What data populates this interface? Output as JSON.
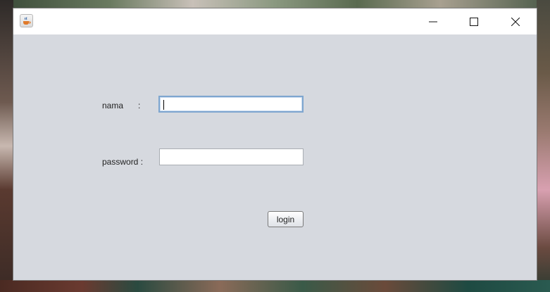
{
  "window": {
    "title": "",
    "icon": "java-coffee-icon",
    "controls": {
      "minimize_icon": "minimize-icon",
      "maximize_icon": "maximize-icon",
      "close_icon": "close-icon"
    }
  },
  "form": {
    "nama_label": "nama",
    "nama_colon": ":",
    "nama_value": "",
    "password_label": "password :",
    "password_value": "",
    "login_button": "login"
  },
  "colors": {
    "window_bg": "#d6d9df",
    "titlebar_bg": "#ffffff",
    "focus_border": "#7ea6cf"
  }
}
